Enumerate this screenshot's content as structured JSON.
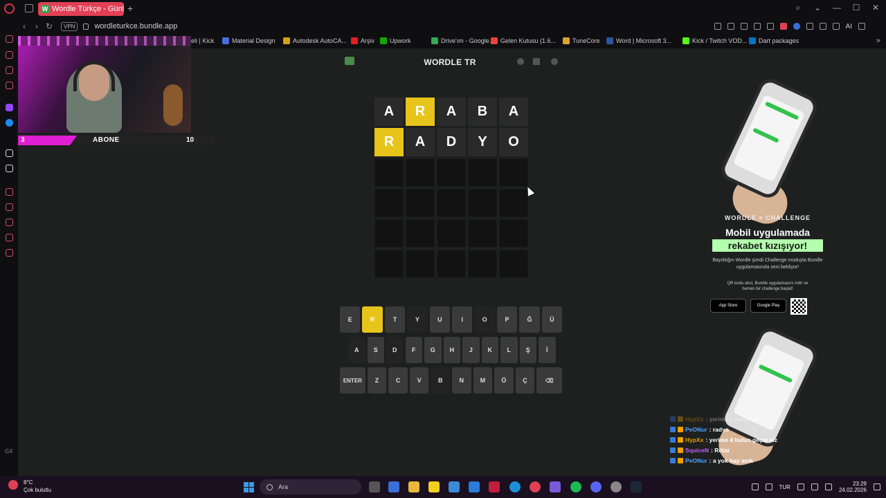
{
  "browser": {
    "tab_title": "Wordle Türkçe - Günlük Ke",
    "tab_favicon": "W",
    "new_tab": "+",
    "url": "wordleturkce.bundle.app",
    "vpn": "VPN",
    "ai_label": "AI",
    "window_controls": [
      "⌕",
      "⌄",
      "—",
      "☐",
      "✕"
    ],
    "bookmarks_partial": "eli | Kick",
    "bookmarks": [
      {
        "label": "Material Design",
        "color": "#4a6ee0"
      },
      {
        "label": "Autodesk AutoCA...",
        "color": "#d4a017"
      },
      {
        "label": "Arşiv",
        "color": "#e02020"
      },
      {
        "label": "Upwork",
        "color": "#14a800"
      },
      {
        "label": "Drive'ım - Google...",
        "color": "#34a853"
      },
      {
        "label": "Gelen Kutusu (1.6...",
        "color": "#ea4335"
      },
      {
        "label": "TuneCore",
        "color": "#e0a030"
      },
      {
        "label": "Word | Microsoft 3...",
        "color": "#2b579a"
      },
      {
        "label": "Kick / Twitch VOD...",
        "color": "#53fc18"
      },
      {
        "label": "Dart packages",
        "color": "#0175c2"
      }
    ]
  },
  "stream_overlay": {
    "sub_current": "3",
    "sub_label": "ABONE",
    "sub_goal": "10",
    "sub_progress": 0.3
  },
  "game": {
    "title": "WORDLE TR",
    "board": [
      [
        {
          "letter": "A",
          "state": "filled"
        },
        {
          "letter": "R",
          "state": "present"
        },
        {
          "letter": "A",
          "state": "filled"
        },
        {
          "letter": "B",
          "state": "filled"
        },
        {
          "letter": "A",
          "state": "filled"
        }
      ],
      [
        {
          "letter": "R",
          "state": "present"
        },
        {
          "letter": "A",
          "state": "filled"
        },
        {
          "letter": "D",
          "state": "filled"
        },
        {
          "letter": "Y",
          "state": "filled"
        },
        {
          "letter": "O",
          "state": "filled"
        }
      ],
      [
        {
          "letter": "",
          "state": "empty"
        },
        {
          "letter": "",
          "state": "empty"
        },
        {
          "letter": "",
          "state": "empty"
        },
        {
          "letter": "",
          "state": "empty"
        },
        {
          "letter": "",
          "state": "empty"
        }
      ],
      [
        {
          "letter": "",
          "state": "empty"
        },
        {
          "letter": "",
          "state": "empty"
        },
        {
          "letter": "",
          "state": "empty"
        },
        {
          "letter": "",
          "state": "empty"
        },
        {
          "letter": "",
          "state": "empty"
        }
      ],
      [
        {
          "letter": "",
          "state": "empty"
        },
        {
          "letter": "",
          "state": "empty"
        },
        {
          "letter": "",
          "state": "empty"
        },
        {
          "letter": "",
          "state": "empty"
        },
        {
          "letter": "",
          "state": "empty"
        }
      ],
      [
        {
          "letter": "",
          "state": "empty"
        },
        {
          "letter": "",
          "state": "empty"
        },
        {
          "letter": "",
          "state": "empty"
        },
        {
          "letter": "",
          "state": "empty"
        },
        {
          "letter": "",
          "state": "empty"
        }
      ]
    ],
    "keyboard": [
      [
        {
          "k": "E"
        },
        {
          "k": "R",
          "state": "present"
        },
        {
          "k": "T"
        },
        {
          "k": "Y",
          "state": "absent"
        },
        {
          "k": "U"
        },
        {
          "k": "I"
        },
        {
          "k": "O",
          "state": "absent"
        },
        {
          "k": "P"
        },
        {
          "k": "Ğ"
        },
        {
          "k": "Ü"
        }
      ],
      [
        {
          "k": "A",
          "state": "absent"
        },
        {
          "k": "S"
        },
        {
          "k": "D",
          "state": "absent"
        },
        {
          "k": "F"
        },
        {
          "k": "G"
        },
        {
          "k": "H"
        },
        {
          "k": "J"
        },
        {
          "k": "K"
        },
        {
          "k": "L"
        },
        {
          "k": "Ş"
        },
        {
          "k": "İ"
        }
      ],
      [
        {
          "k": "ENTER",
          "wide": true
        },
        {
          "k": "Z"
        },
        {
          "k": "C"
        },
        {
          "k": "V"
        },
        {
          "k": "B",
          "state": "absent"
        },
        {
          "k": "N"
        },
        {
          "k": "M"
        },
        {
          "k": "Ö"
        },
        {
          "k": "Ç"
        },
        {
          "k": "⌫",
          "wide": true
        }
      ]
    ]
  },
  "ad": {
    "brand": "WORDLE × CHALLENGE",
    "headline1": "Mobil uygulamada",
    "headline2": "rekabet kızışıyor!",
    "description": "Bayıldığın Wordle şimdi Challenge moduyla Bundle uygulamasında seni bekliyor!",
    "qr_text": "QR kodu okut, Bundle uygulamasını indir ve hemen bir challenge başlat!",
    "app_store": "App Store",
    "google_play": "Google Play"
  },
  "chat": [
    {
      "user": "HypXx",
      "message": ": yerime 4 bulun geçin siz",
      "color": "#e6a000",
      "faded": true
    },
    {
      "user": "PeONur",
      "message": ": radyo",
      "color": "#4aa3ff"
    },
    {
      "user": "HypXx",
      "message": ": yerime 4 bulun geçin siz",
      "color": "#e6a000"
    },
    {
      "user": "SquiceN",
      "message": ": Rötar",
      "color": "#c060ff"
    },
    {
      "user": "PeONur",
      "message": ": a yok hay amk",
      "color": "#4aa3ff"
    }
  ],
  "taskbar": {
    "temperature": "8°C",
    "weather": "Çok bulutlu",
    "search_placeholder": "Ara",
    "language": "TUR",
    "time": "23:29",
    "date": "24.02.2026"
  }
}
